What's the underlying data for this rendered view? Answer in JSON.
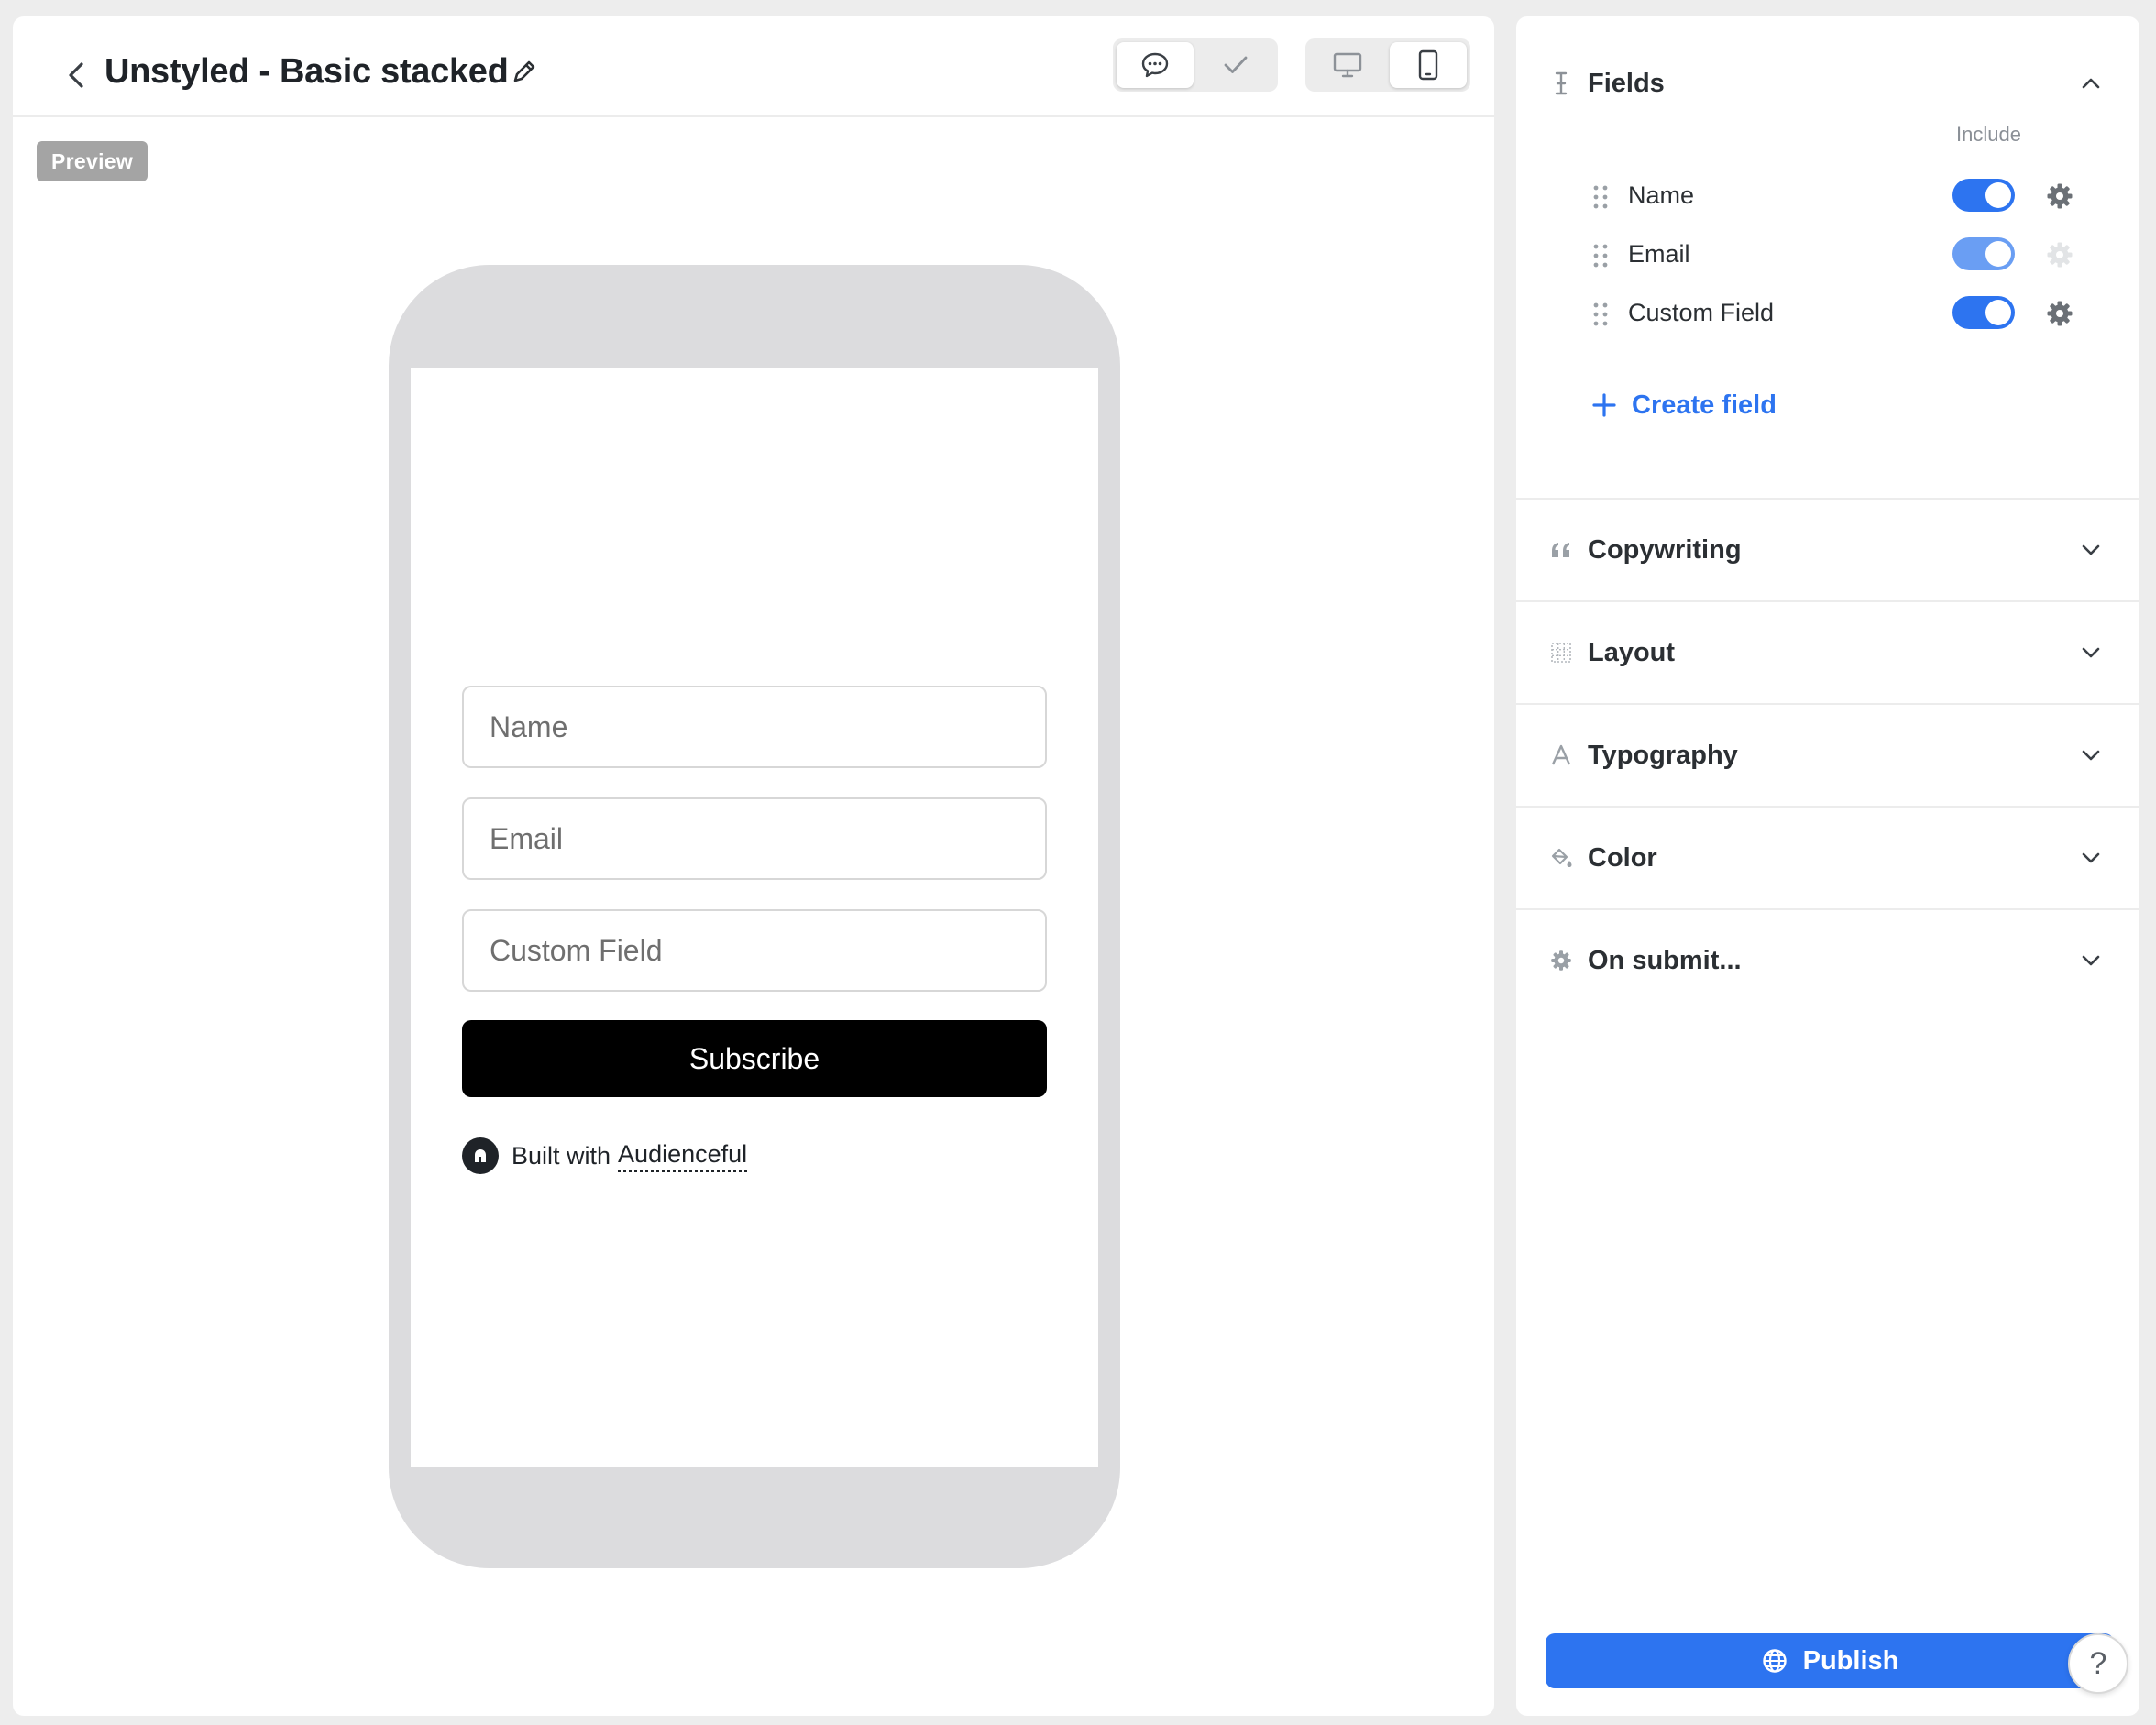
{
  "editor": {
    "title": "Unstyled - Basic stacked",
    "preview_badge": "Preview"
  },
  "preview_form": {
    "inputs": [
      {
        "placeholder": "Name"
      },
      {
        "placeholder": "Email"
      },
      {
        "placeholder": "Custom Field"
      }
    ],
    "submit_label": "Subscribe",
    "branding_prefix": "Built with",
    "branding_link": "Audienceful"
  },
  "sidebar": {
    "fields": {
      "title": "Fields",
      "include_label": "Include",
      "items": [
        {
          "label": "Name",
          "included": true,
          "settings_enabled": true
        },
        {
          "label": "Email",
          "included": true,
          "settings_enabled": false
        },
        {
          "label": "Custom Field",
          "included": true,
          "settings_enabled": true
        }
      ],
      "create_label": "Create field"
    },
    "sections": [
      {
        "title": "Copywriting",
        "icon": "quote-icon"
      },
      {
        "title": "Layout",
        "icon": "grid-icon"
      },
      {
        "title": "Typography",
        "icon": "type-icon"
      },
      {
        "title": "Color",
        "icon": "paint-bucket-icon"
      },
      {
        "title": "On submit...",
        "icon": "gear-icon"
      }
    ],
    "publish_label": "Publish"
  },
  "help": {
    "label": "?"
  },
  "colors": {
    "accent": "#2d74f0",
    "accent_light": "#6a9ef3",
    "button_dark": "#000000",
    "phone_frame": "#dcdcde"
  }
}
